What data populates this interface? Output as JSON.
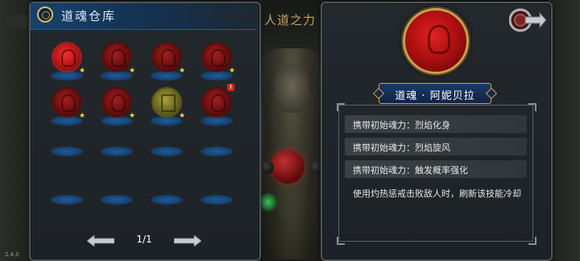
{
  "left_panel": {
    "title": "道魂仓库",
    "slots": [
      {
        "type": "red",
        "tone": "bright",
        "star": true,
        "alert": false
      },
      {
        "type": "red",
        "tone": "dim",
        "star": true,
        "alert": false
      },
      {
        "type": "red",
        "tone": "dim",
        "star": true,
        "alert": false
      },
      {
        "type": "red",
        "tone": "dim",
        "star": true,
        "alert": false
      },
      {
        "type": "red",
        "tone": "dim",
        "star": true,
        "alert": false
      },
      {
        "type": "red",
        "tone": "dim",
        "star": true,
        "alert": false
      },
      {
        "type": "yellow",
        "tone": "normal",
        "star": true,
        "alert": false
      },
      {
        "type": "red",
        "tone": "dim",
        "star": false,
        "alert": true
      },
      {
        "type": "empty"
      },
      {
        "type": "empty"
      },
      {
        "type": "empty"
      },
      {
        "type": "empty"
      },
      {
        "type": "empty"
      },
      {
        "type": "empty"
      },
      {
        "type": "empty"
      },
      {
        "type": "empty"
      }
    ],
    "star_glyph": "★",
    "alert_glyph": "!",
    "pagination": {
      "page_text": "1/1"
    }
  },
  "background": {
    "tab_text": "人道之力",
    "version": "2.4.0"
  },
  "right_panel": {
    "name": "道魂 · 阿妮贝拉",
    "abilities": [
      "携带初始魂力：烈焰化身",
      "携带初始魂力：烈焰旋风",
      "携带初始魂力：触发概率强化"
    ],
    "description": "使用灼热惩戒击败敌人时，刷新该技能冷却"
  },
  "colors": {
    "accent_gold": "#c8a050",
    "slot_blue": "#1f5c9c",
    "orb_red": "#c01818",
    "orb_yellow": "#a8a040",
    "star": "#ffd23a",
    "alert": "#e02020"
  },
  "icons": {
    "prev": "arrow-left-icon",
    "next": "arrow-right-icon",
    "close": "close-icon",
    "title": "ring-icon"
  }
}
